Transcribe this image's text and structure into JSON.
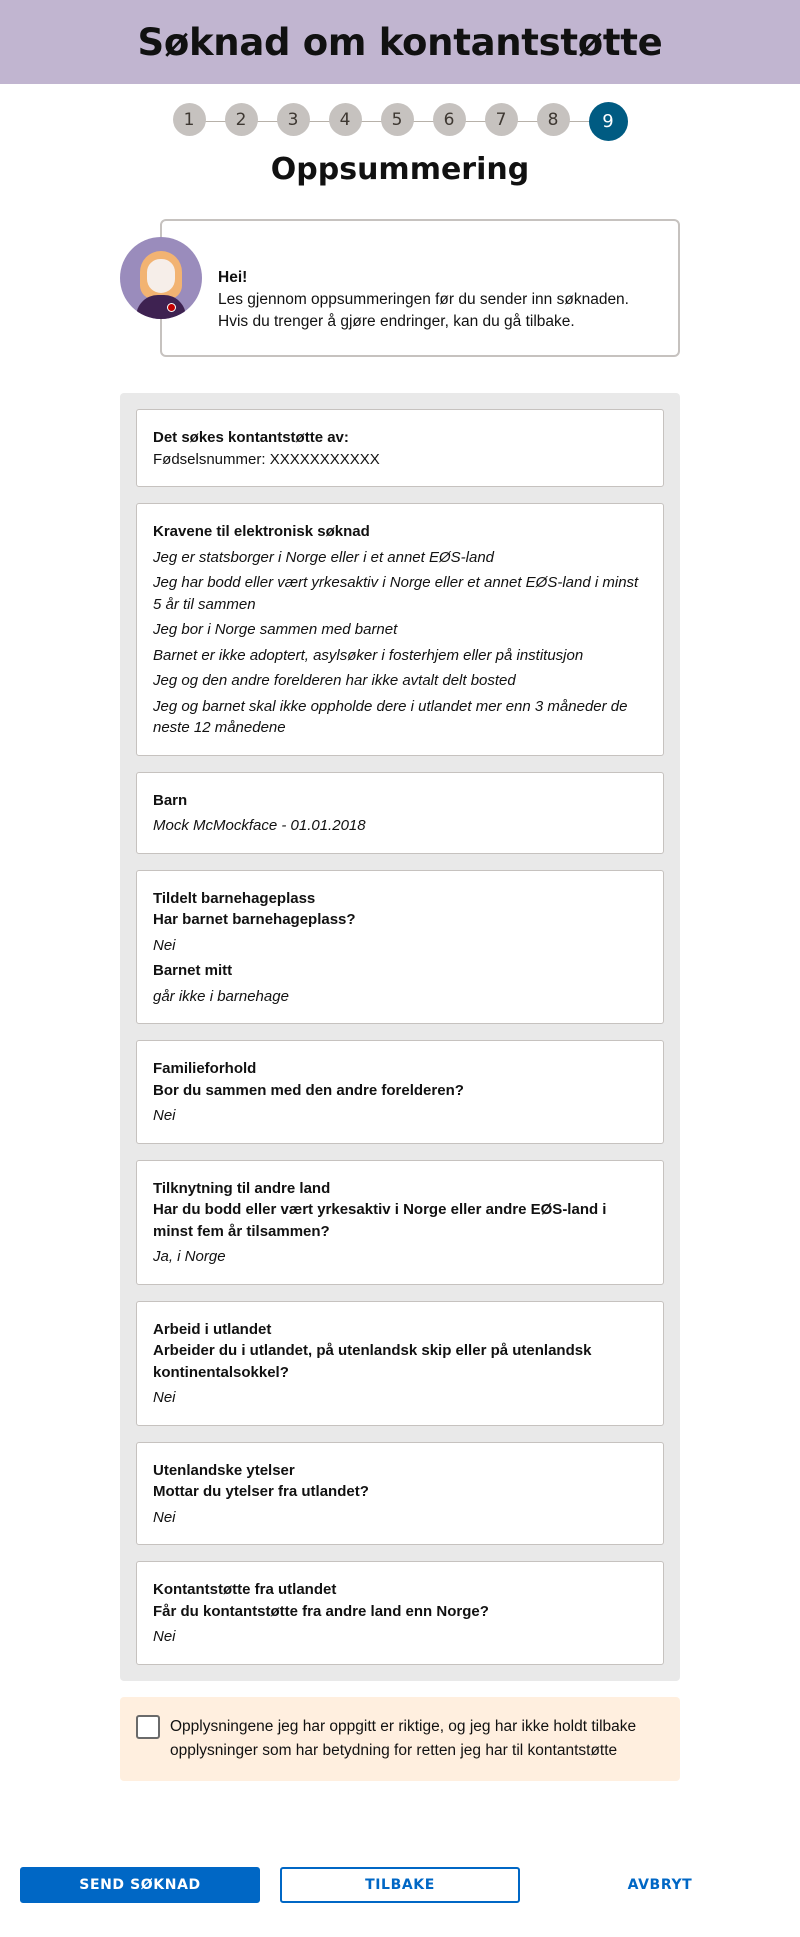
{
  "header": {
    "title": "Søknad om kontantstøtte"
  },
  "stepper": {
    "steps": [
      "1",
      "2",
      "3",
      "4",
      "5",
      "6",
      "7",
      "8",
      "9"
    ],
    "active_step": "9"
  },
  "page_title": "Oppsummering",
  "veileder": {
    "greeting": "Hei!",
    "text": "Les gjennom oppsummeringen før du sender inn søknaden. Hvis du trenger å gjøre endringer, kan du gå tilbake."
  },
  "summary": {
    "applicant": {
      "title": "Det søkes kontantstøtte av:",
      "value": "Fødselsnummer: XXXXXXXXXXX"
    },
    "requirements": {
      "title": "Kravene til elektronisk søknad",
      "items": [
        "Jeg er statsborger i Norge eller i et annet EØS-land",
        "Jeg har bodd eller vært yrkesaktiv i Norge eller et annet EØS-land i minst 5 år til sammen",
        "Jeg bor i Norge sammen med barnet",
        "Barnet er ikke adoptert, asylsøker i fosterhjem eller på institusjon",
        "Jeg og den andre forelderen har ikke avtalt delt bosted",
        "Jeg og barnet skal ikke oppholde dere i utlandet mer enn 3 måneder de neste 12 månedene"
      ]
    },
    "child": {
      "title": "Barn",
      "value": "Mock McMockface - 01.01.2018"
    },
    "kindergarten": {
      "title": "Tildelt barnehageplass",
      "question": "Har barnet barnehageplass?",
      "answer": "Nei",
      "question2": "Barnet mitt",
      "answer2": "går ikke i barnehage"
    },
    "family": {
      "title": "Familieforhold",
      "question": "Bor du sammen med den andre forelderen?",
      "answer": "Nei"
    },
    "other_countries": {
      "title": "Tilknytning til andre land",
      "question": "Har du bodd eller vært yrkesaktiv i Norge eller andre EØS-land i minst fem år tilsammen?",
      "answer": "Ja, i Norge"
    },
    "work_abroad": {
      "title": "Arbeid i utlandet",
      "question": "Arbeider du i utlandet, på utenlandsk skip eller på utenlandsk kontinentalsokkel?",
      "answer": "Nei"
    },
    "foreign_benefits": {
      "title": "Utenlandske ytelser",
      "question": "Mottar du ytelser fra utlandet?",
      "answer": "Nei"
    },
    "foreign_support": {
      "title": "Kontantstøtte fra utlandet",
      "question": "Får du kontantstøtte fra andre land enn Norge?",
      "answer": "Nei"
    }
  },
  "confirmation": {
    "text": "Opplysningene jeg har oppgitt er riktige, og jeg har ikke holdt tilbake opplysninger som har betydning for retten jeg har til kontantstøtte",
    "checked": false
  },
  "actions": {
    "send_label": "SEND SØKNAD",
    "back_label": "TILBAKE",
    "cancel_label": "AVBRYT"
  },
  "colors": {
    "header_bg": "#c1b5d0",
    "active_step": "#005b82",
    "primary": "#0067c5",
    "confirm_bg": "#ffefdf"
  }
}
